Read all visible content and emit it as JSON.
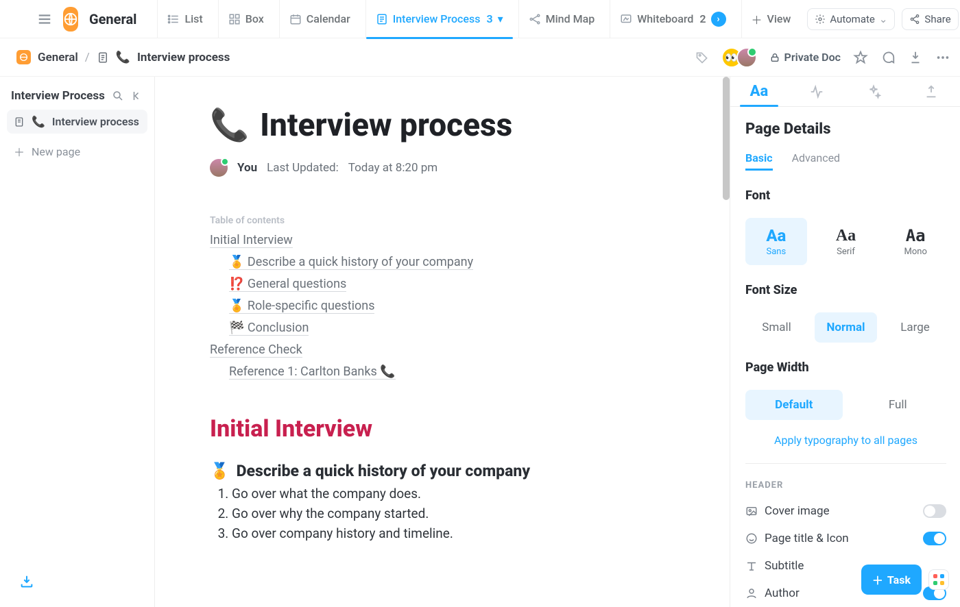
{
  "workspace_name": "General",
  "views": {
    "list": "List",
    "box": "Box",
    "calendar": "Calendar",
    "interview": {
      "label": "Interview Process",
      "badge": "3"
    },
    "mindmap": "Mind Map",
    "whiteboard": {
      "label": "Whiteboard",
      "badge": "2"
    },
    "view": "View"
  },
  "automate": "Automate",
  "share": "Share",
  "breadcrumb": {
    "root": "General",
    "sep": "/",
    "page": "Interview process",
    "private": "Private Doc"
  },
  "leftnav": {
    "title": "Interview Process",
    "item": "Interview process",
    "newpage": "New page"
  },
  "doc": {
    "title": "Interview process",
    "you": "You",
    "updated_label": "Last Updated:",
    "updated_val": "Today at 8:20 pm",
    "toc_caption": "Table of contents",
    "toc_1": "Initial Interview",
    "toc_1a": "🏅 Describe a quick history of your company",
    "toc_1b": "⁉️ General questions",
    "toc_1c": "🏅 Role-specific questions",
    "toc_1d": "🏁 Conclusion",
    "toc_2": "Reference Check",
    "toc_2a": "Reference 1: Carlton Banks 📞",
    "h1": "Initial Interview",
    "h2": "Describe a quick history of your company",
    "l1": "Go over what the company does.",
    "l2": "Go over why the company started.",
    "l3": "Go over company history and timeline."
  },
  "rpanel": {
    "title": "Page Details",
    "tab_basic": "Basic",
    "tab_adv": "Advanced",
    "font": "Font",
    "font_sans": "Sans",
    "font_serif": "Serif",
    "font_mono": "Mono",
    "fontsize": "Font Size",
    "size_s": "Small",
    "size_m": "Normal",
    "size_l": "Large",
    "pwidth": "Page Width",
    "w_def": "Default",
    "w_full": "Full",
    "apply_all": "Apply typography to all pages",
    "header_cap": "HEADER",
    "cover": "Cover image",
    "pti": "Page title & Icon",
    "subtitle": "Subtitle",
    "author": "Author"
  },
  "fab_task": "Task"
}
